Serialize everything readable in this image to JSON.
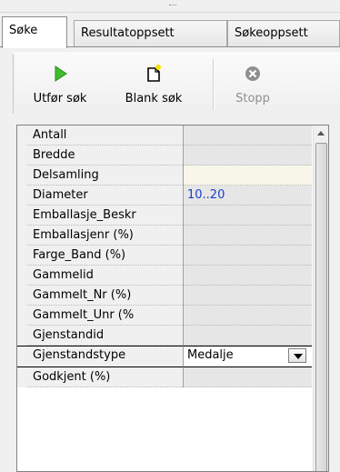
{
  "tabs": [
    {
      "label": "Søke",
      "active": true
    },
    {
      "label": "Resultatoppsett",
      "active": false
    },
    {
      "label": "Søkeoppsett",
      "active": false
    }
  ],
  "toolbar": {
    "run_search": "Utfør søk",
    "blank_search": "Blank søk",
    "stop": "Stopp",
    "colors": {
      "play": "#3fbf2a",
      "stop_disabled": "#8f8f8f",
      "star": "#f2e200"
    }
  },
  "grid": {
    "rows": [
      {
        "name": "Antall",
        "value": ""
      },
      {
        "name": "Bredde",
        "value": ""
      },
      {
        "name": "Delsamling",
        "value": ""
      },
      {
        "name": "Diameter",
        "value": "10..20"
      },
      {
        "name": "Emballasje_Beskr",
        "value": ""
      },
      {
        "name": "Emballasjenr (%)",
        "value": ""
      },
      {
        "name": "Farge_Band (%)",
        "value": ""
      },
      {
        "name": "Gammelid",
        "value": ""
      },
      {
        "name": "Gammelt_Nr (%)",
        "value": ""
      },
      {
        "name": "Gammelt_Unr (%",
        "value": ""
      },
      {
        "name": "Gjenstandid",
        "value": ""
      },
      {
        "name": "Gjenstandstype",
        "value": "Medalje"
      },
      {
        "name": "Godkjent (%)",
        "value": ""
      }
    ]
  }
}
